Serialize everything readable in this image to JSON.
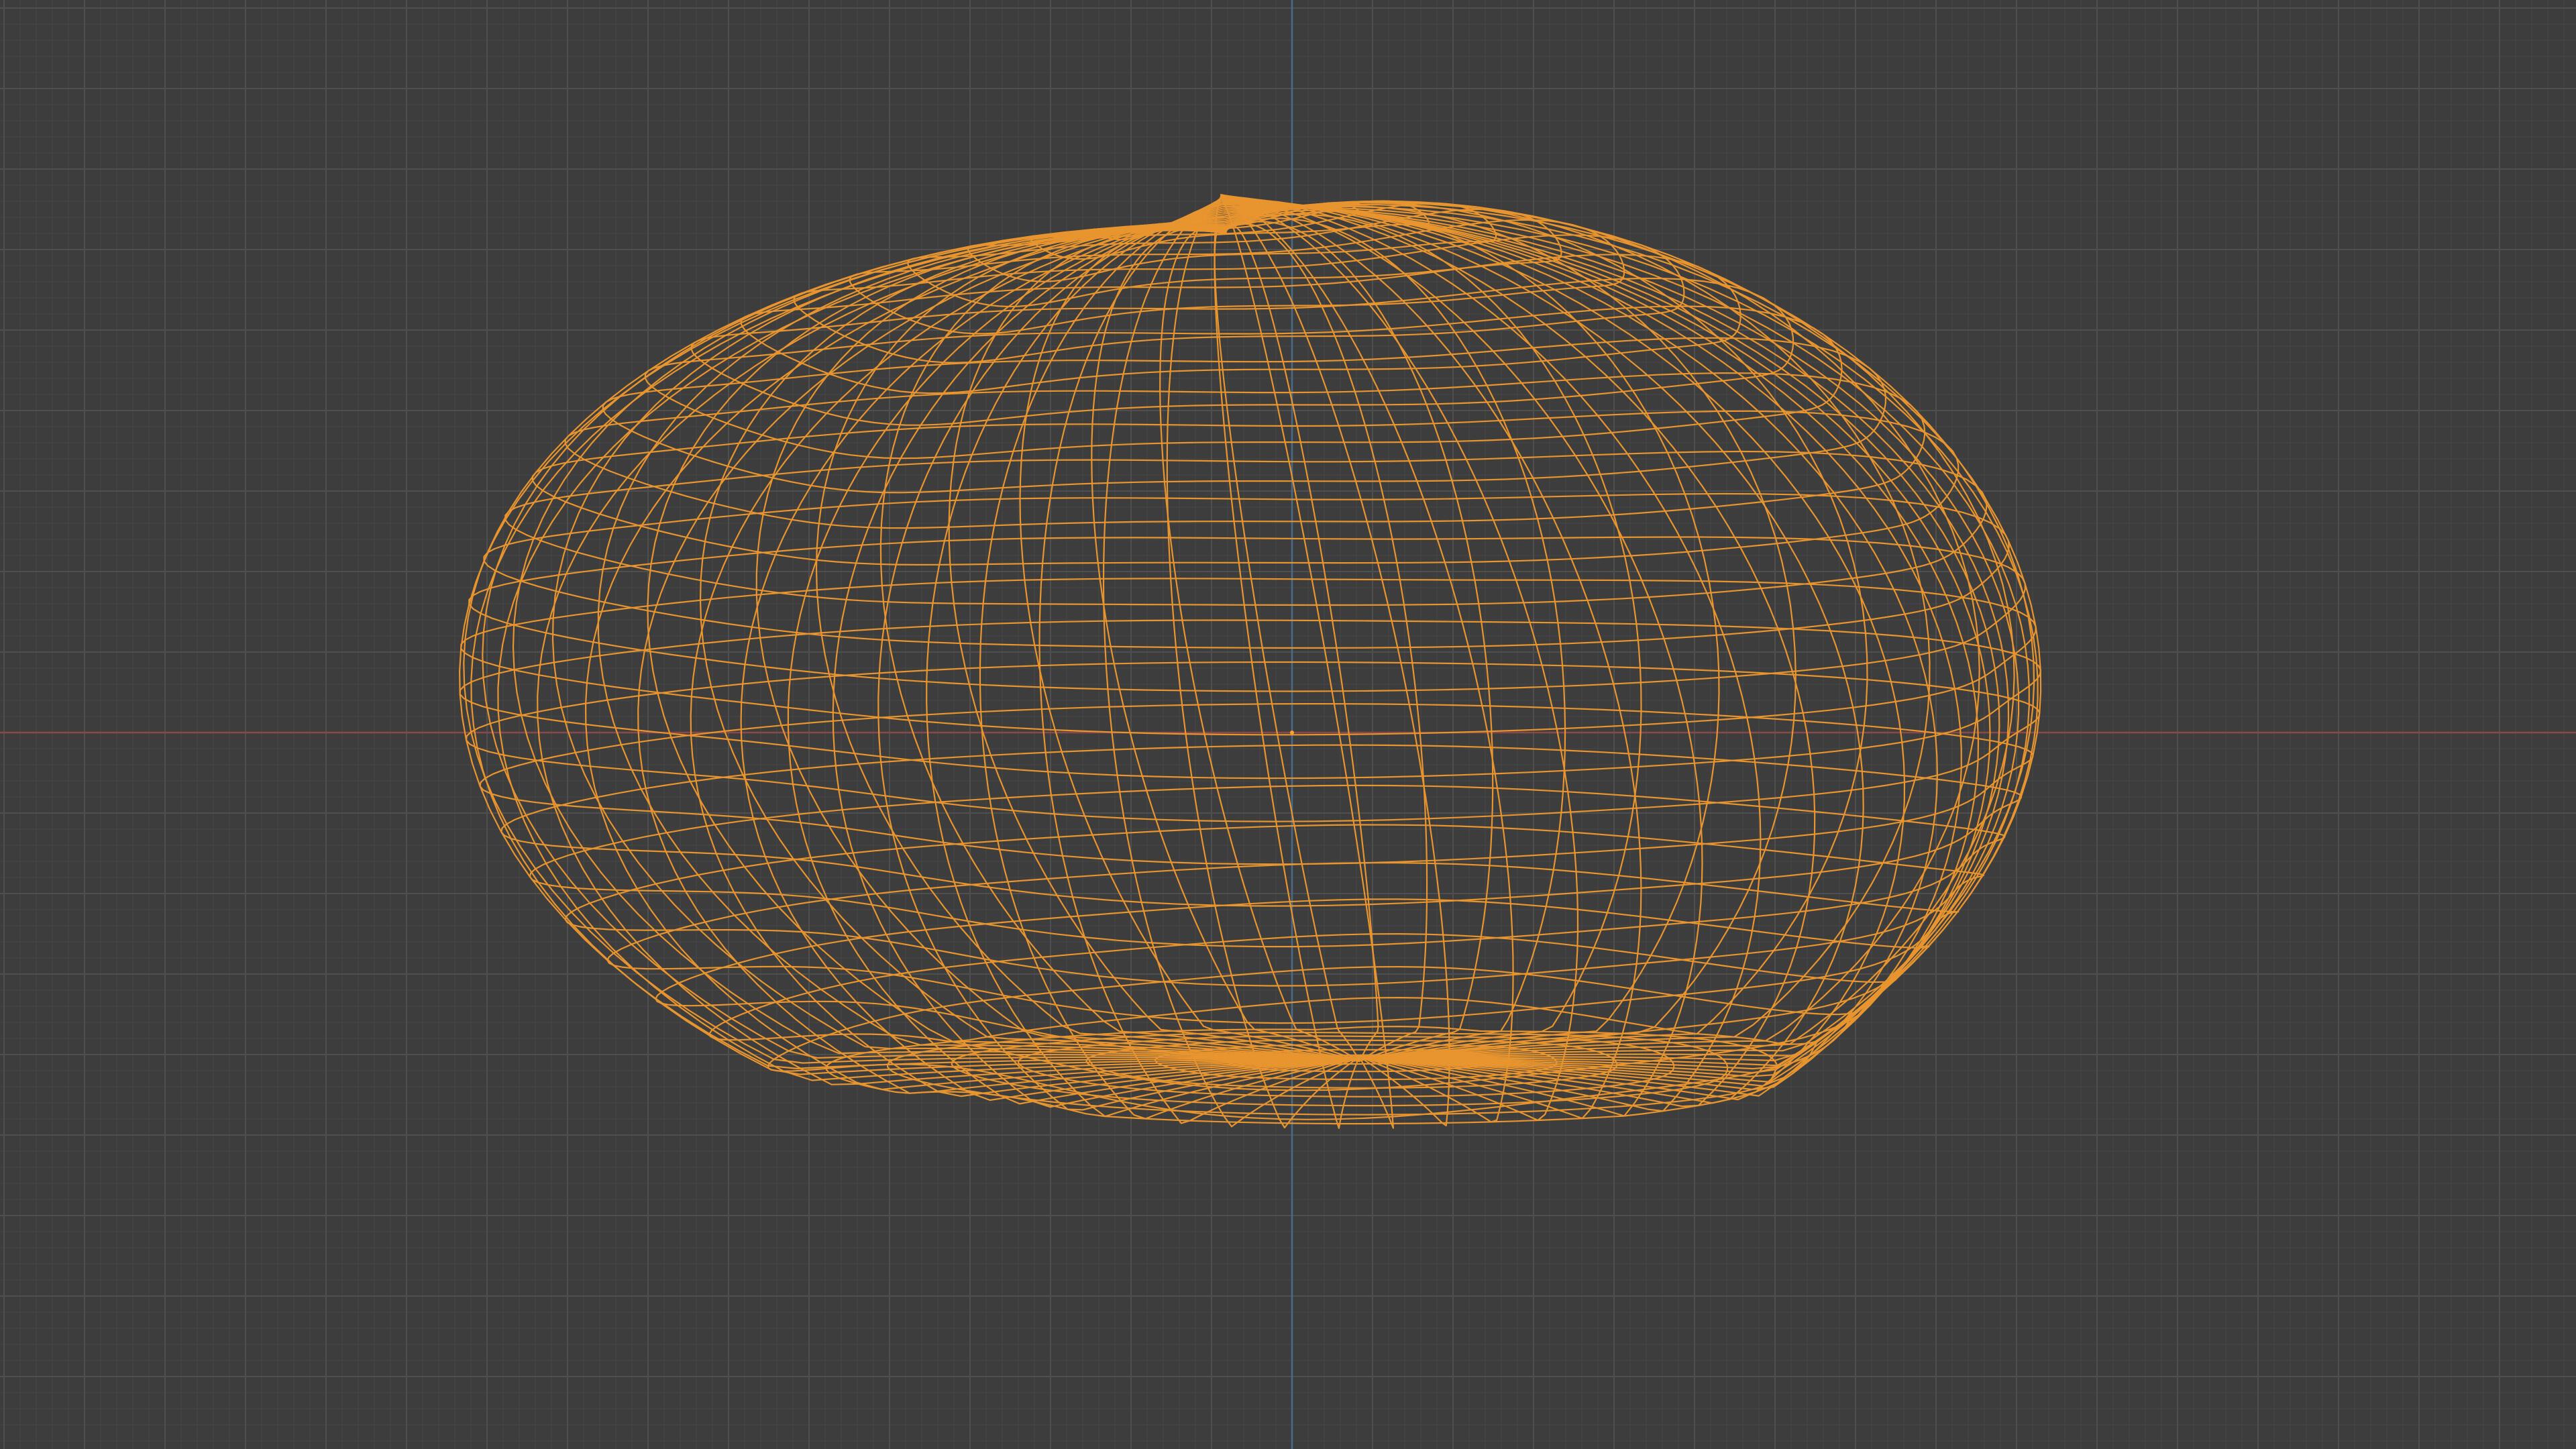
{
  "app": {
    "view": "3D Viewport",
    "shading": "wireframe",
    "projection": "orthographic"
  },
  "colors": {
    "background": "#3d3d3d",
    "grid_minor": "#464646",
    "grid_major": "#4f4f4f",
    "axis_x": "#8a4848",
    "axis_z": "#4a6a8a",
    "wire_selected": "#e8952f",
    "origin": "#ffa030"
  },
  "scene": {
    "object": {
      "name": "deformed-sphere",
      "selected": true,
      "display": "wireframe"
    },
    "grid": {
      "visible": true,
      "axes_visible": [
        "x",
        "z"
      ]
    }
  }
}
